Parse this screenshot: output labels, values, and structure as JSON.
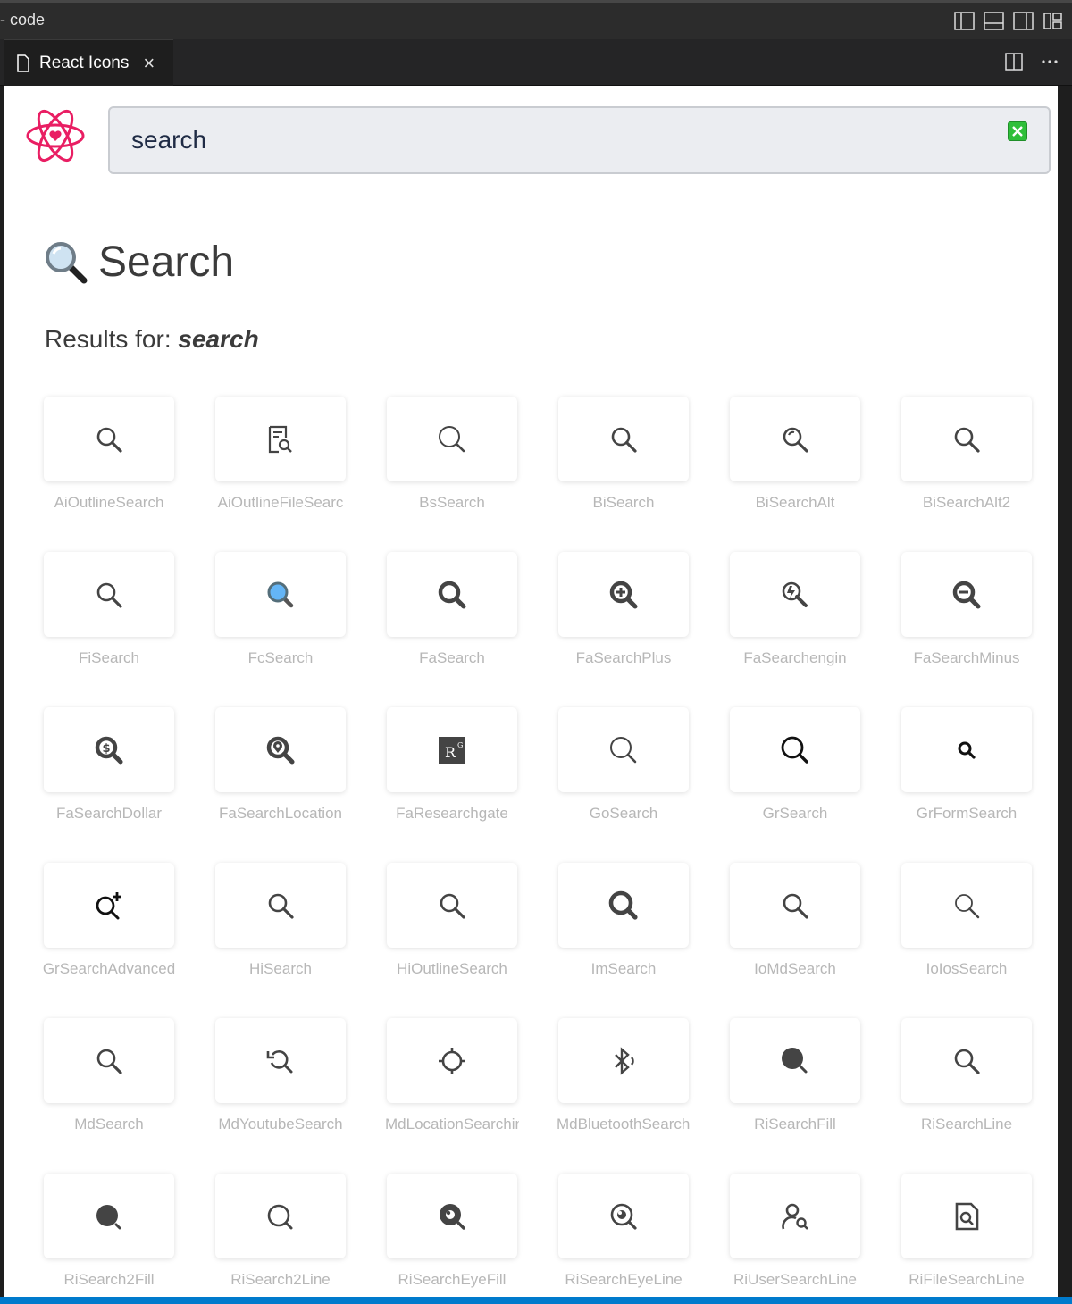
{
  "window": {
    "title": "- code"
  },
  "tab": {
    "label": "React Icons",
    "close_glyph": "×"
  },
  "search": {
    "value": "search",
    "placeholder": ""
  },
  "heading": {
    "emoji": "🔍",
    "text": "Search"
  },
  "results": {
    "prefix": "Results for: ",
    "query": "search"
  },
  "colors": {
    "logo": "#e91e63",
    "clear_button": "#2fbf3a",
    "accent": "#007acc"
  },
  "icons": [
    {
      "name": "AiOutlineSearch",
      "icon": "search"
    },
    {
      "name": "AiOutlineFileSearc",
      "icon": "file-search"
    },
    {
      "name": "BsSearch",
      "icon": "search-thin-large"
    },
    {
      "name": "BiSearch",
      "icon": "search"
    },
    {
      "name": "BiSearchAlt",
      "icon": "search-alt"
    },
    {
      "name": "BiSearchAlt2",
      "icon": "search"
    },
    {
      "name": "FiSearch",
      "icon": "search"
    },
    {
      "name": "FcSearch",
      "icon": "search-blue"
    },
    {
      "name": "FaSearch",
      "icon": "search-bold"
    },
    {
      "name": "FaSearchPlus",
      "icon": "search-plus"
    },
    {
      "name": "FaSearchengin",
      "icon": "searchengin"
    },
    {
      "name": "FaSearchMinus",
      "icon": "search-minus"
    },
    {
      "name": "FaSearchDollar",
      "icon": "search-dollar"
    },
    {
      "name": "FaSearchLocation",
      "icon": "search-location"
    },
    {
      "name": "FaResearchgate",
      "icon": "researchgate"
    },
    {
      "name": "GoSearch",
      "icon": "search-thin-large"
    },
    {
      "name": "GrSearch",
      "icon": "search-black"
    },
    {
      "name": "GrFormSearch",
      "icon": "search-small"
    },
    {
      "name": "GrSearchAdvanced",
      "icon": "search-advanced"
    },
    {
      "name": "HiSearch",
      "icon": "search"
    },
    {
      "name": "HiOutlineSearch",
      "icon": "search"
    },
    {
      "name": "ImSearch",
      "icon": "search-bold-large"
    },
    {
      "name": "IoMdSearch",
      "icon": "search"
    },
    {
      "name": "IoIosSearch",
      "icon": "search-thin"
    },
    {
      "name": "MdSearch",
      "icon": "search"
    },
    {
      "name": "MdYoutubeSearch",
      "icon": "youtube-search"
    },
    {
      "name": "MdLocationSearching",
      "icon": "location-searching"
    },
    {
      "name": "MdBluetoothSearching",
      "icon": "bluetooth-searching"
    },
    {
      "name": "RiSearchFill",
      "icon": "search-fill"
    },
    {
      "name": "RiSearchLine",
      "icon": "search"
    },
    {
      "name": "RiSearch2Fill",
      "icon": "search-2-fill"
    },
    {
      "name": "RiSearch2Line",
      "icon": "search-2-line"
    },
    {
      "name": "RiSearchEyeFill",
      "icon": "search-eye-fill"
    },
    {
      "name": "RiSearchEyeLine",
      "icon": "search-eye-line"
    },
    {
      "name": "RiUserSearchLine",
      "icon": "user-search"
    },
    {
      "name": "RiFileSearchLine",
      "icon": "file-search-line"
    }
  ]
}
